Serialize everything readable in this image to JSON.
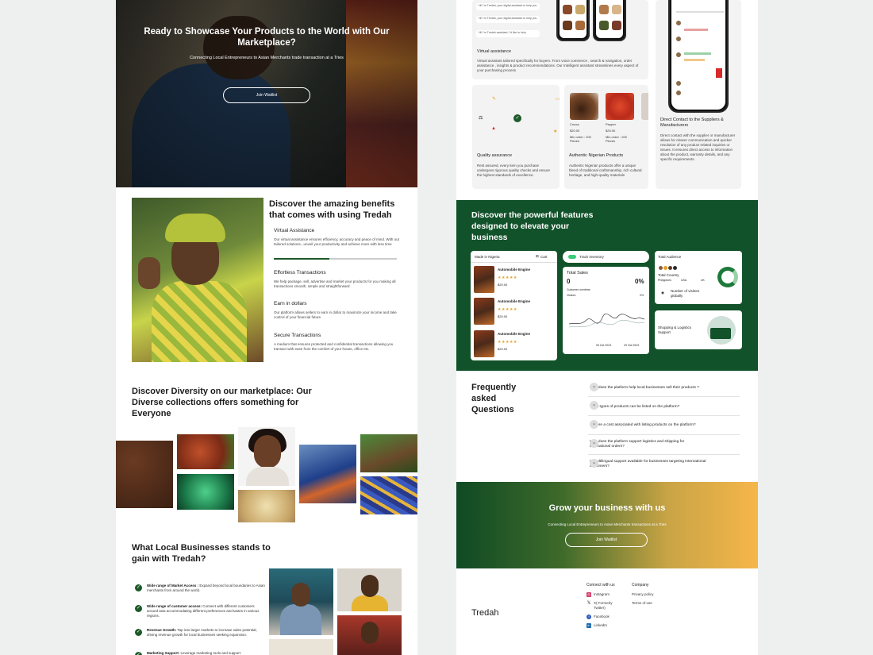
{
  "hero": {
    "title": "Ready to Showcase Your Products to the World with Our Marketplace?",
    "subtitle": "Connecting Local Entrepreneurs to Asian Merchants trade transaction at a Tries",
    "button": "Join Waitlist"
  },
  "benefits": {
    "title": "Discover the amazing benefits that comes with using Tredah",
    "progress": 0.45,
    "items": [
      {
        "title": "Virtual Assistance",
        "text": "Our virtual assistance ensures efficiency, accuracy and peace of mind. With out tailored solutions...unveil your productivity and achieve more with less time"
      },
      {
        "title": "Effortless Transactions",
        "text": "We help package, sell, advertise and market your products for you making all transactions smooth, simple and straightforward"
      },
      {
        "title": "Earn in dollars",
        "text": "Our platform allows sellers to earn in dollar to maximize your income and take control of your financial future"
      },
      {
        "title": "Secure Transactions",
        "text": "A medium that ensures protected and confidential transactions allowing you transact with ease from the comfort of your house, office etc."
      }
    ]
  },
  "diversity": {
    "title": "Discover Diversity on our marketplace: Our Diverse collections offers something for Everyone"
  },
  "gains": {
    "title": "What Local Businesses stands to gain with Tredah?",
    "items": [
      {
        "bold": "Wide range of Market Access :",
        "text": " Expand beyond local boundaries to Asian merchants from around the world."
      },
      {
        "bold": "Wide range of customer access:",
        "text": " Connect with different customers around asia accommodating different preferences and tastes in various regions."
      },
      {
        "bold": "Revenue Growth:",
        "text": " Tap into larger markets to increase sales potential, driving revenue growth for local businesses seeking expansion."
      },
      {
        "bold": "Marketing Support:",
        "text": " Leverage marketing tools and support"
      }
    ]
  },
  "services": {
    "virtual": {
      "title": "Virtual assistance",
      "text": "Virtual assistant tailored specifically for buyers. From voice commerce , search & navigation, order assistance , insights & product recommendations. Our Intelligent assistant streamlines every aspect of your purchasing process",
      "chat": [
        "Hi! I'm Tredah, your digital assistant to help you",
        "Hi! I'm Tredah, your digital assistant to help you",
        "Hi! I'm Tredah assistant, I'd like to help"
      ]
    },
    "quality": {
      "title": "Quality assurance",
      "text": "Rest assured, every item you purchase undergoes rigorous quality checks and ensure the highest standards of excellence."
    },
    "authentic": {
      "title": "Authentic Nigerian Products",
      "text": "Authentic Nigerian products offer a unique blend of traditional craftsmanship, rich cultural heritage, and high-quality materials",
      "products": [
        {
          "name": "Cocoa",
          "price": "$20.00",
          "min": "Min order : 200 Pieces"
        },
        {
          "name": "Pepper",
          "price": "$25.00",
          "min": "Min order : 200 Pieces"
        }
      ]
    },
    "direct": {
      "title": "Direct Contact to the Suppliers & Manufacturers",
      "text": "Direct contact with the supplier or manufacturer allows for clearer communication and quicker resolution of any product related inquiries or issues. It ensures direct access to information about the product, warranty details, and any specific requirements."
    }
  },
  "features": {
    "title": "Discover the powerful features designed to elevate your business",
    "made_in": "Made in Nigeria",
    "cart": "Cart",
    "products": [
      {
        "name": "Automobile Engine",
        "stars": "★★★★★",
        "price": "$20.00"
      },
      {
        "name": "Automobile Engine",
        "stars": "★★★★★",
        "price": "$20.00"
      },
      {
        "name": "Automobile Engine",
        "stars": "★★★★★",
        "price": "$20.00"
      }
    ],
    "track": "Track Inventory",
    "sales": {
      "title": "Total Sales",
      "value": "0",
      "percent": "0%",
      "sub": "Customer overtime",
      "visitors": "Visitors",
      "pct2": "0%",
      "from": "05 Oct 2023",
      "to": "29 Oct 2023"
    },
    "audience": {
      "title": "Total Audience",
      "country": "Total Country",
      "c1": "Philippines",
      "c2": "USA",
      "c3": "UK",
      "visitors": "Number of visitors globally"
    },
    "shipping": "Shopping & Logistics Support"
  },
  "faq": {
    "title": "Frequently asked Questions",
    "items": [
      "How does the platform help local businesses sell their products ?",
      "What types of products can be listed on the platform?",
      "Is there a cost associated with listing products on the platform?",
      "How does the platform support logistics and shipping for international orders?",
      "Is multilingual support available for businesses targeting international customers?"
    ]
  },
  "grow": {
    "title": "Grow your  business with us",
    "subtitle": "Connecting Local Entrepreneurs to Asian Merchants transactions at a Tries",
    "button": "Join Waitlist"
  },
  "footer": {
    "brand": "Tredah",
    "connect_title": "Connect with us",
    "socials": [
      "Instagram",
      "X( Formerly Twitter)",
      "Facebook",
      "LinkedIn"
    ],
    "company_title": "Company",
    "company_links": [
      "Privacy policy",
      "Terms of use"
    ]
  },
  "colors": {
    "brand_green": "#12522a",
    "accent_orange": "#f6b64a",
    "star": "#e6a020"
  }
}
